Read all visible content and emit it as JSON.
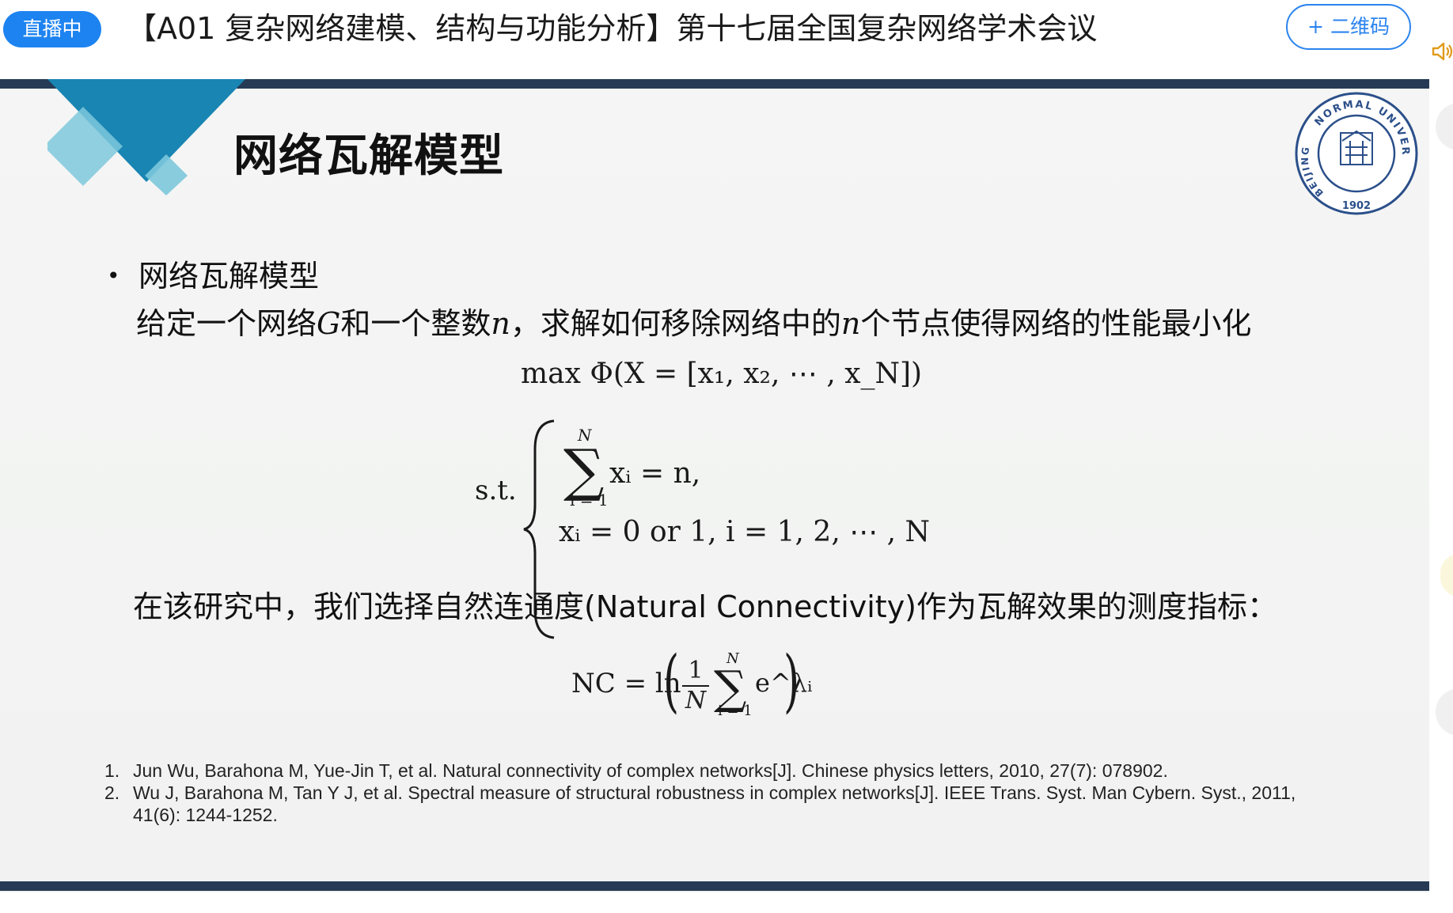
{
  "topbar": {
    "live_label": "直播中",
    "title": "【A01 复杂网络建模、结构与功能分析】第十七届全国复杂网络学术会议",
    "qr_button": "+ 二维码"
  },
  "slide": {
    "heading": "网络瓦解模型",
    "bullet": "网络瓦解模型",
    "description": {
      "part1": "给定一个网络",
      "var_g": "G",
      "part2": "和一个整数",
      "var_n": "n",
      "part3": "，求解如何移除网络中的",
      "var_n2": "n",
      "part4": "个节点使得网络的性能最小化"
    },
    "objective": "max Φ(X = [x₁, x₂, ⋯ , x_N])",
    "constraint_label": "s.t.",
    "constraint1": "xᵢ = n,",
    "constraint2": "xᵢ = 0  or  1,  i = 1, 2, ⋯ , N",
    "sum_upper": "N",
    "sum_lower": "i = 1",
    "natural_connectivity_text": "在该研究中，我们选择自然连通度(Natural Connectivity)作为瓦解效果的测度指标：",
    "nc_formula": {
      "lhs": "NC = ln",
      "frac_num": "1",
      "frac_den": "N",
      "sum_upper": "N",
      "sum_lower": "i = 1",
      "term": "e^λᵢ"
    },
    "references": [
      {
        "num": "1.",
        "text": "Jun Wu, Barahona M, Yue-Jin T, et al. Natural connectivity of complex networks[J]. Chinese physics letters, 2010, 27(7): 078902."
      },
      {
        "num": "2.",
        "text": "Wu J, Barahona M, Tan Y J, et al. Spectral measure of structural robustness in complex networks[J]. IEEE Trans. Syst. Man Cybern. Syst., 2011, 41(6): 1244-1252."
      }
    ],
    "logo": {
      "top_text": "NORMAL UNIVERSITY",
      "left_text": "BEIJING",
      "year": "1902"
    }
  },
  "colors": {
    "live_badge": "#1d83f0",
    "qr_border": "#2b84ee",
    "rule": "#263a55",
    "deco_dark": "#1985b3",
    "deco_light": "#7cc8dc"
  }
}
